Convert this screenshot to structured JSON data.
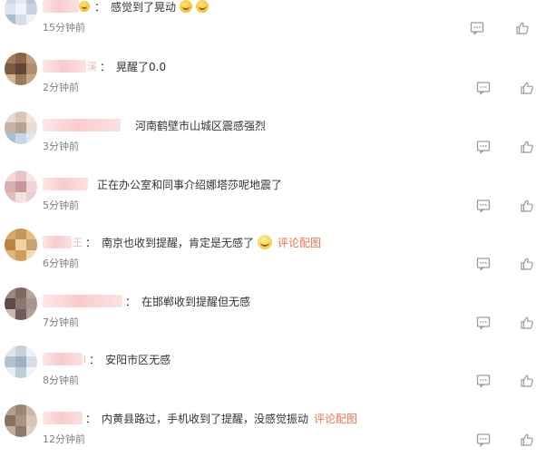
{
  "comments": [
    {
      "name_suffix": "",
      "emoji_before": "",
      "text": "感觉到了晃动",
      "emoji_after": [
        "grinning-face-with-sweat",
        "grinning-face-with-sweat"
      ],
      "link": "",
      "time": "15分钟前"
    },
    {
      "name_suffix": "溪",
      "emoji_before": "",
      "text": "晃醒了0.0",
      "emoji_after": [],
      "link": "",
      "time": "2分钟前"
    },
    {
      "name_suffix": "",
      "emoji_before": "",
      "text": "河南鹤壁市山城区震感强烈",
      "emoji_after": [],
      "link": "",
      "time": "3分钟前"
    },
    {
      "name_suffix": "",
      "emoji_before": "",
      "text": "正在办公室和同事介绍娜塔莎呢地震了",
      "emoji_after": [],
      "link": "",
      "time": "5分钟前"
    },
    {
      "name_suffix": "王",
      "emoji_before": "",
      "text": "南京也收到提醒，肯定是无感了",
      "emoji_after": [
        "slightly-smiling-face"
      ],
      "link": "评论配图",
      "time": "6分钟前"
    },
    {
      "name_suffix": "",
      "emoji_before": "",
      "text": "在邯郸收到提醒但无感",
      "emoji_after": [],
      "link": "",
      "time": "7分钟前"
    },
    {
      "name_suffix": "i",
      "emoji_before": "",
      "text": "安阳市区无感",
      "emoji_after": [],
      "link": "",
      "time": "8分钟前"
    },
    {
      "name_suffix": "",
      "emoji_before": "",
      "text": "内黄县路过，手机收到了提醒，没感觉振动",
      "emoji_after": [],
      "link": "评论配图",
      "time": "12分钟前"
    }
  ],
  "colors": {
    "link": "#eb7350",
    "time": "#808080",
    "text": "#333333",
    "icon": "#9a9a9a"
  },
  "icons": {
    "reply": "comment-icon",
    "like": "thumbs-up-icon"
  }
}
